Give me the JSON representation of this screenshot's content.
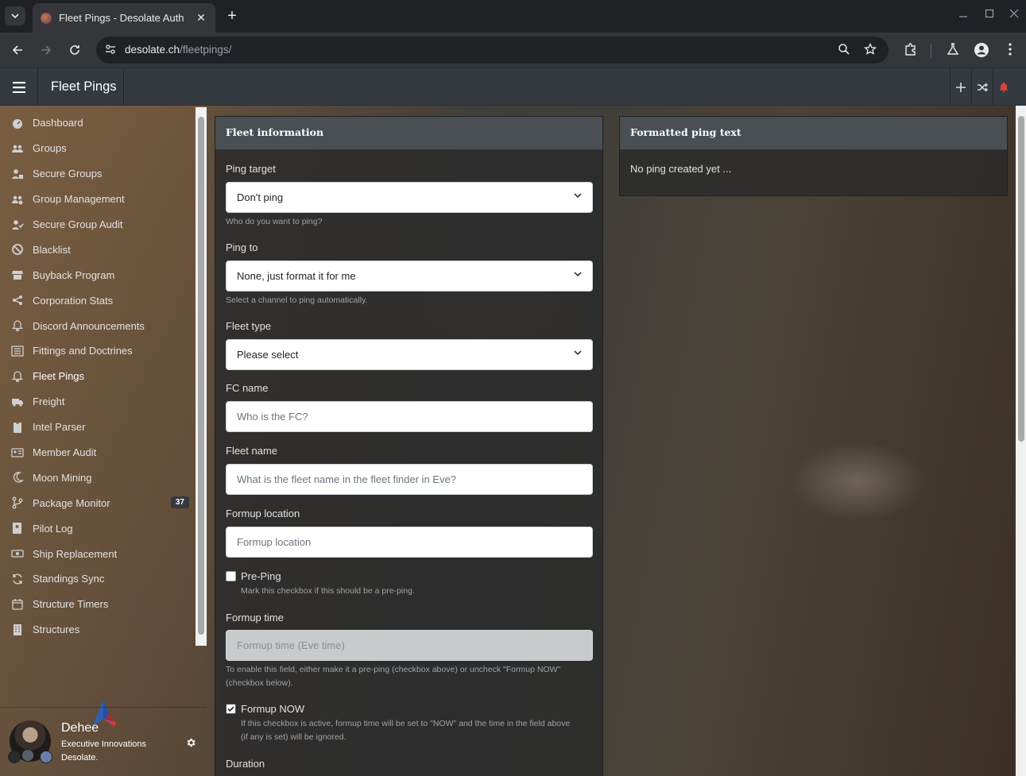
{
  "browser": {
    "tab_title": "Fleet Pings - Desolate Auth",
    "url_host": "desolate.ch",
    "url_path": "/fleetpings/"
  },
  "header": {
    "title": "Fleet Pings"
  },
  "sidebar": {
    "items": [
      {
        "label": "Dashboard",
        "icon": "dashboard-icon"
      },
      {
        "label": "Groups",
        "icon": "users-icon"
      },
      {
        "label": "Secure Groups",
        "icon": "user-lock-icon"
      },
      {
        "label": "Group Management",
        "icon": "users-cog-icon"
      },
      {
        "label": "Secure Group Audit",
        "icon": "user-check-icon"
      },
      {
        "label": "Blacklist",
        "icon": "ban-icon"
      },
      {
        "label": "Buyback Program",
        "icon": "store-icon"
      },
      {
        "label": "Corporation Stats",
        "icon": "share-icon"
      },
      {
        "label": "Discord Announcements",
        "icon": "bell-icon"
      },
      {
        "label": "Fittings and Doctrines",
        "icon": "list-icon"
      },
      {
        "label": "Fleet Pings",
        "icon": "bell-icon",
        "active": true
      },
      {
        "label": "Freight",
        "icon": "truck-icon"
      },
      {
        "label": "Intel Parser",
        "icon": "clipboard-icon"
      },
      {
        "label": "Member Audit",
        "icon": "id-card-icon"
      },
      {
        "label": "Moon Mining",
        "icon": "moon-icon"
      },
      {
        "label": "Package Monitor",
        "icon": "code-branch-icon",
        "badge": "37"
      },
      {
        "label": "Pilot Log",
        "icon": "address-book-icon"
      },
      {
        "label": "Ship Replacement",
        "icon": "money-icon"
      },
      {
        "label": "Standings Sync",
        "icon": "sync-icon"
      },
      {
        "label": "Structure Timers",
        "icon": "calendar-icon"
      },
      {
        "label": "Structures",
        "icon": "building-icon"
      }
    ]
  },
  "user": {
    "name": "Dehee",
    "corporation": "Executive Innovations",
    "alliance": "Desolate."
  },
  "fleet_form": {
    "title": "Fleet information",
    "ping_target": {
      "label": "Ping target",
      "value": "Don't ping",
      "help": "Who do you want to ping?"
    },
    "ping_to": {
      "label": "Ping to",
      "value": "None, just format it for me",
      "help": "Select a channel to ping automatically."
    },
    "fleet_type": {
      "label": "Fleet type",
      "value": "Please select"
    },
    "fc_name": {
      "label": "FC name",
      "placeholder": "Who is the FC?"
    },
    "fleet_name": {
      "label": "Fleet name",
      "placeholder": "What is the fleet name in the fleet finder in Eve?"
    },
    "formup_location": {
      "label": "Formup location",
      "placeholder": "Formup location"
    },
    "pre_ping": {
      "label": "Pre-Ping",
      "help": "Mark this checkbox if this should be a pre-ping.",
      "checked": false
    },
    "formup_time": {
      "label": "Formup time",
      "placeholder": "Formup time (Eve time)",
      "help1": "To enable this field, either make it a pre-ping (checkbox above) or uncheck \"Formup NOW\"",
      "help2": "(checkbox below)."
    },
    "formup_now": {
      "label": "Formup NOW",
      "help1": "If this checkbox is active, formup time will be set to \"NOW\" and the time in the field above",
      "help2": "(if any is set) will be ignored.",
      "checked": true
    },
    "duration": {
      "label": "Duration"
    }
  },
  "ping_panel": {
    "title": "Formatted ping text",
    "text": "No ping created yet ..."
  },
  "colors": {
    "header_bg": "#343a40",
    "panel_head": "#4a4f54",
    "notification_bell": "#e0423b"
  }
}
